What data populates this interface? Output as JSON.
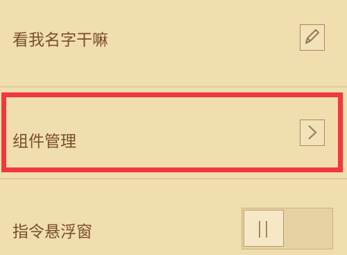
{
  "settings": {
    "items": [
      {
        "label": "看我名字干嘛",
        "icon": "pencil-icon"
      },
      {
        "label": "组件管理",
        "icon": "chevron-right-icon"
      },
      {
        "label": "指令悬浮窗",
        "toggle_state": "off"
      }
    ]
  },
  "colors": {
    "background": "#f0deae",
    "label_text": "#7a4f2b",
    "highlight_border": "#f0393d",
    "icon_border": "#a98765",
    "toggle_track": "#e6d2a0"
  }
}
